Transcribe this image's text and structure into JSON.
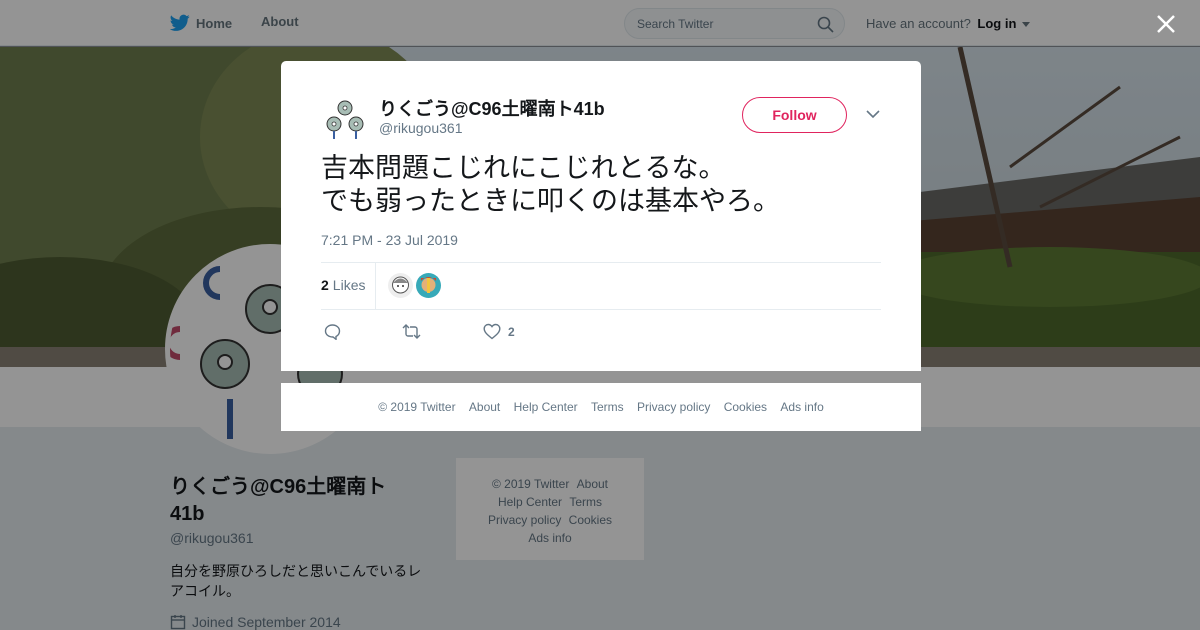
{
  "nav": {
    "home_label": "Home",
    "about_label": "About",
    "search_placeholder": "Search Twitter",
    "have_account": "Have an account?",
    "login_label": "Log in"
  },
  "profile": {
    "name": "りくごう@C96土曜南ト41b",
    "handle": "@rikugou361",
    "bio": "自分を野原ひろしだと思いこんでいるレアコイル。",
    "joined": "Joined September 2014"
  },
  "side_footer": {
    "copyright": "© 2019 Twitter",
    "about": "About",
    "help": "Help Center",
    "terms": "Terms",
    "privacy": "Privacy policy",
    "cookies": "Cookies",
    "ads": "Ads info"
  },
  "tweet": {
    "author_name": "りくごう@C96土曜南ト41b",
    "author_handle": "@rikugou361",
    "follow_label": "Follow",
    "text": "吉本問題こじれにこじれとるな。\nでも弱ったときに叩くのは基本やろ。",
    "timestamp": "7:21 PM - 23 Jul 2019",
    "likes_count": "2",
    "likes_label": "Likes",
    "action_like_count": "2"
  },
  "modal_footer": {
    "copyright": "© 2019 Twitter",
    "about": "About",
    "help": "Help Center",
    "terms": "Terms",
    "privacy": "Privacy policy",
    "cookies": "Cookies",
    "ads": "Ads info"
  },
  "colors": {
    "brand_blue": "#1da1f2",
    "follow_red": "#e0245e",
    "muted_text": "#657786"
  },
  "icons": [
    "twitter-bird-icon",
    "search-icon",
    "close-icon",
    "chevron-down-icon",
    "reply-icon",
    "retweet-icon",
    "heart-icon",
    "calendar-icon"
  ]
}
